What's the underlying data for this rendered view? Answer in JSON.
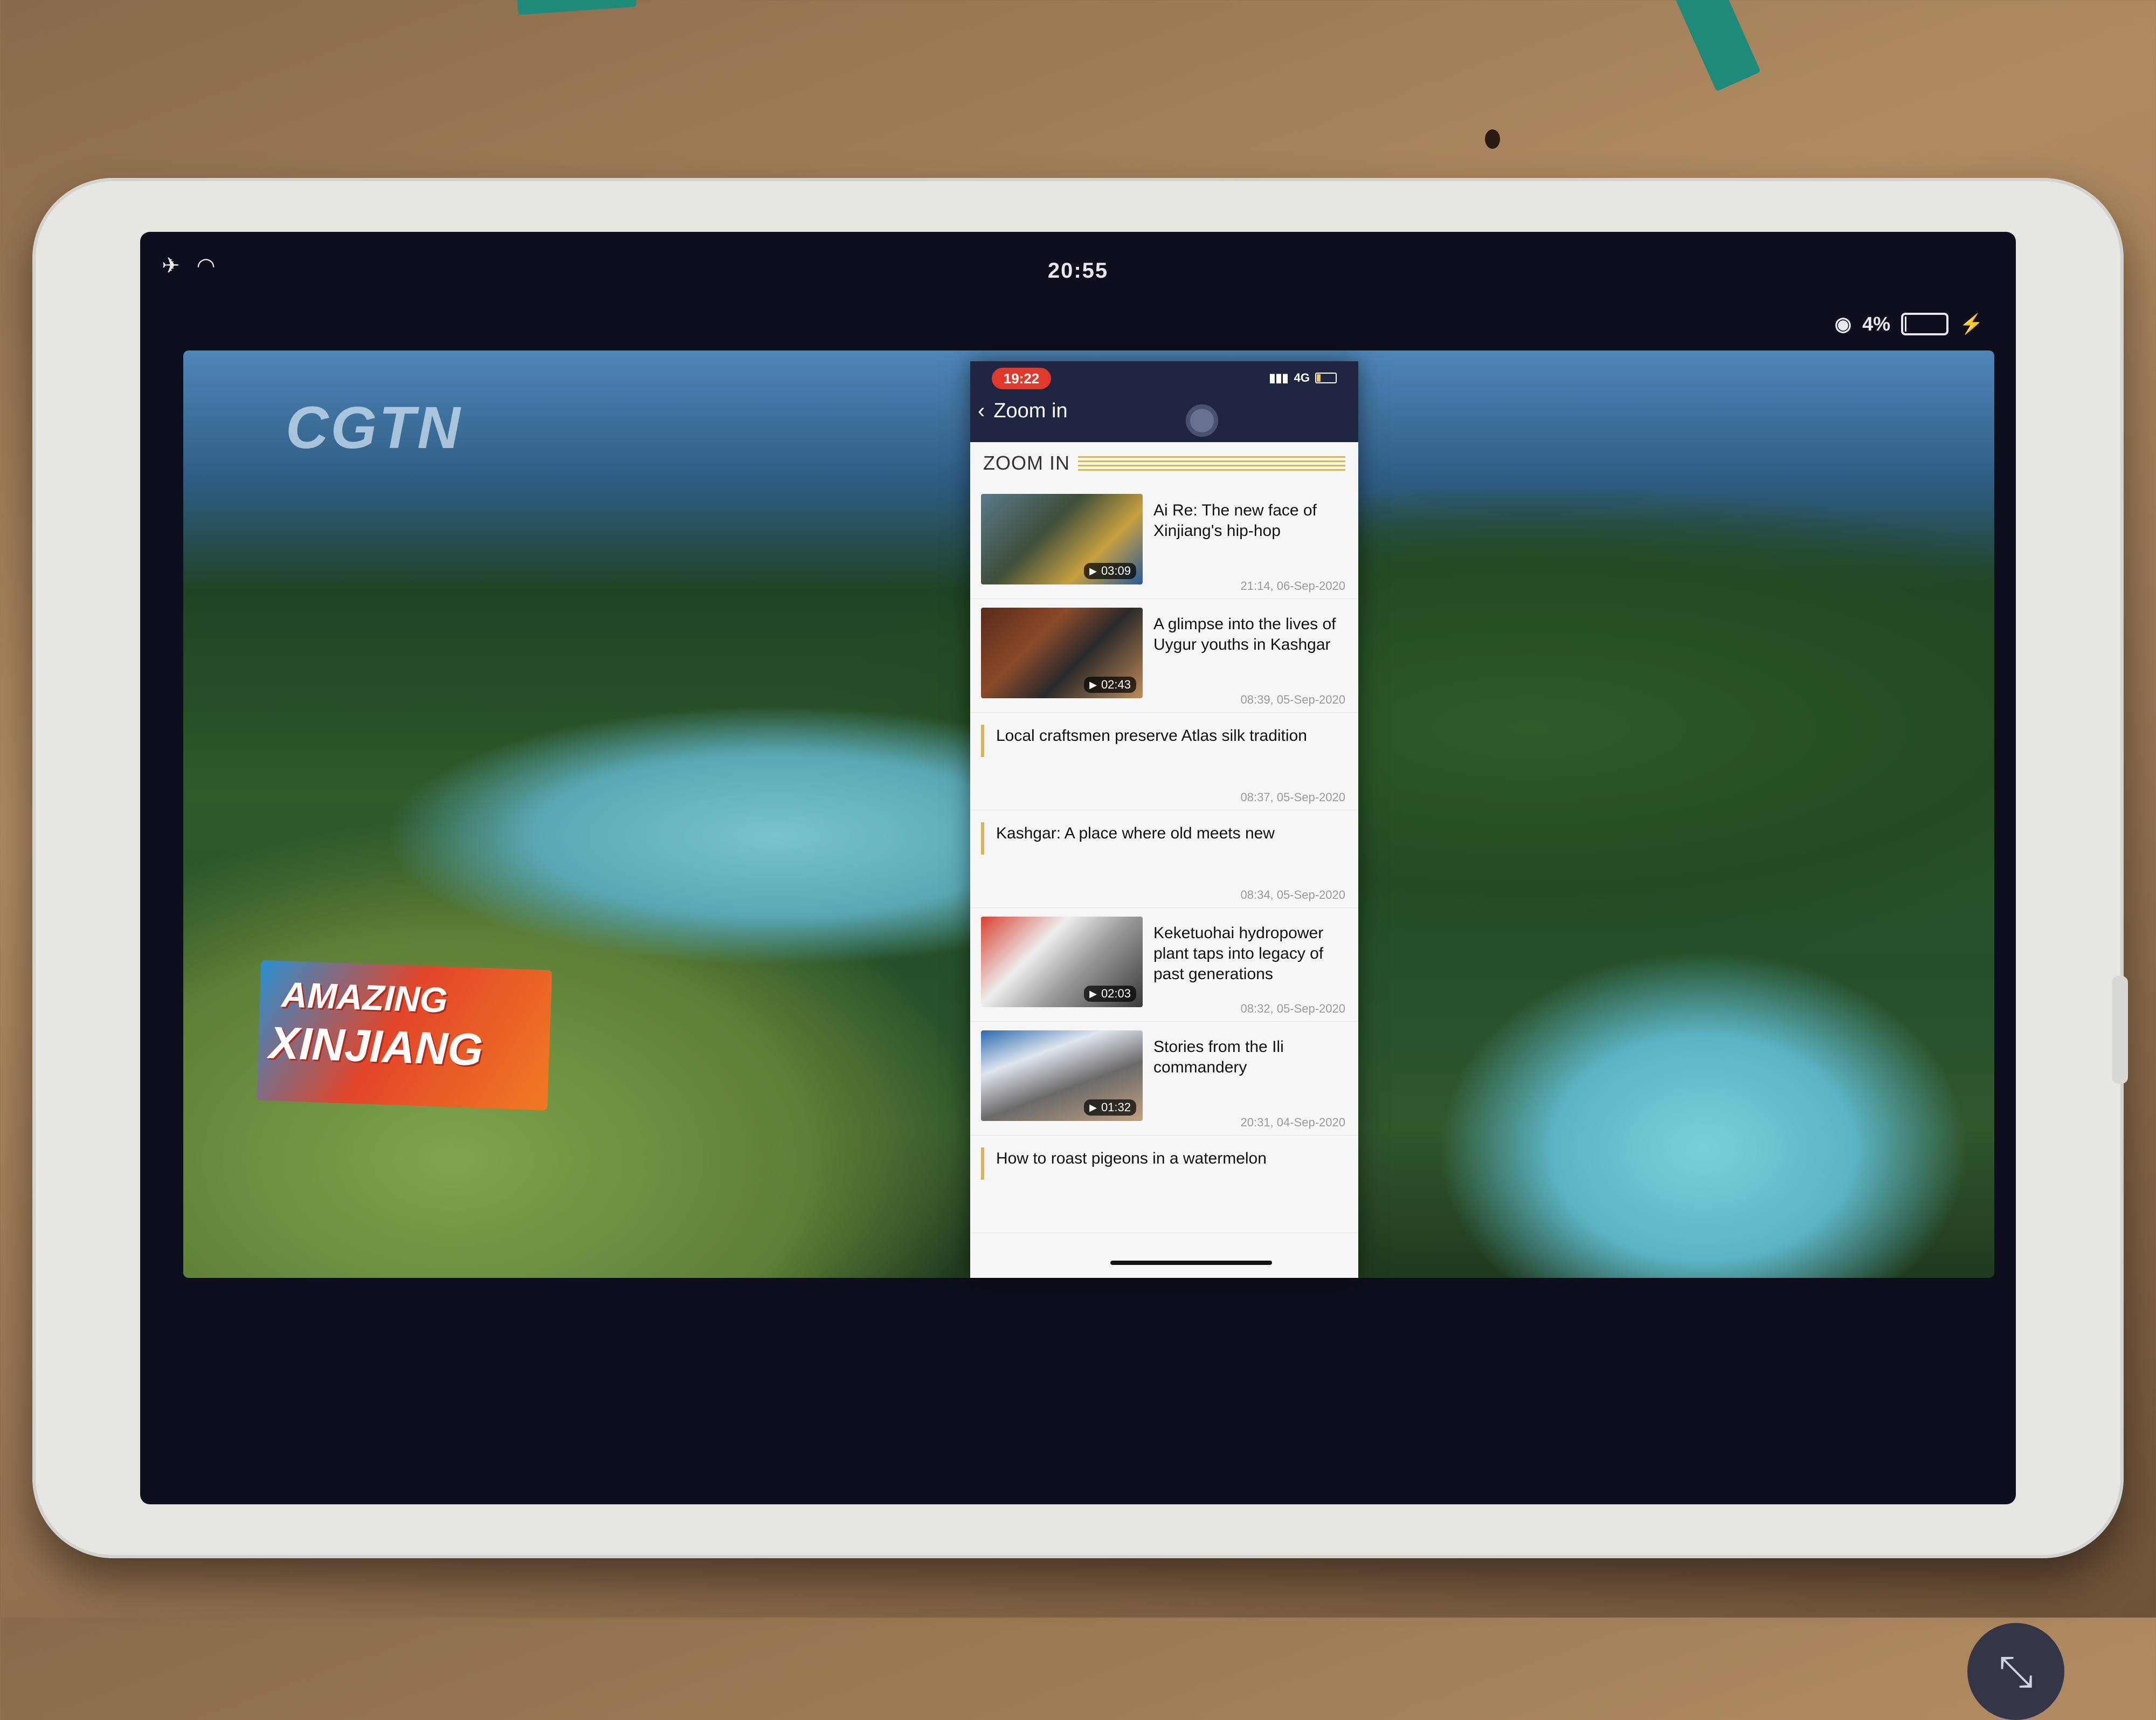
{
  "status_bar": {
    "left_icons": "✈ ︎◠",
    "time": "20:55",
    "battery_percent": "4%",
    "charging_icon": "⚡"
  },
  "video": {
    "channel_logo": "CGTN",
    "badge_line1": "AMAZING",
    "badge_line2": "XINJIANG"
  },
  "phone": {
    "time": "19:22",
    "signal_text": "4G",
    "back_label": "Zoom in",
    "section_title": "ZOOM IN",
    "feed": [
      {
        "type": "video",
        "title": "Ai Re: The new face of Xinjiang's hip-hop",
        "duration": "03:09",
        "date": "21:14, 06-Sep-2020"
      },
      {
        "type": "video",
        "title": "A glimpse into the lives of Uygur youths in Kashgar",
        "duration": "02:43",
        "date": "08:39, 05-Sep-2020"
      },
      {
        "type": "text",
        "title": "Local craftsmen preserve Atlas silk tradition",
        "date": "08:37, 05-Sep-2020"
      },
      {
        "type": "text",
        "title": "Kashgar: A place where old meets new",
        "date": "08:34, 05-Sep-2020"
      },
      {
        "type": "video",
        "title": "Keketuohai hydropower plant taps into legacy of past generations",
        "duration": "02:03",
        "date": "08:32, 05-Sep-2020"
      },
      {
        "type": "video",
        "title": "Stories from the Ili commandery",
        "duration": "01:32",
        "date": "20:31, 04-Sep-2020"
      },
      {
        "type": "text",
        "title": "How to roast pigeons in a watermelon",
        "date": ""
      }
    ]
  },
  "exit_fullscreen_icon": "⤡",
  "colors": {
    "phone_header": "#1f2540",
    "time_pill": "#e0392b",
    "accent_gold": "#d9b45a"
  }
}
